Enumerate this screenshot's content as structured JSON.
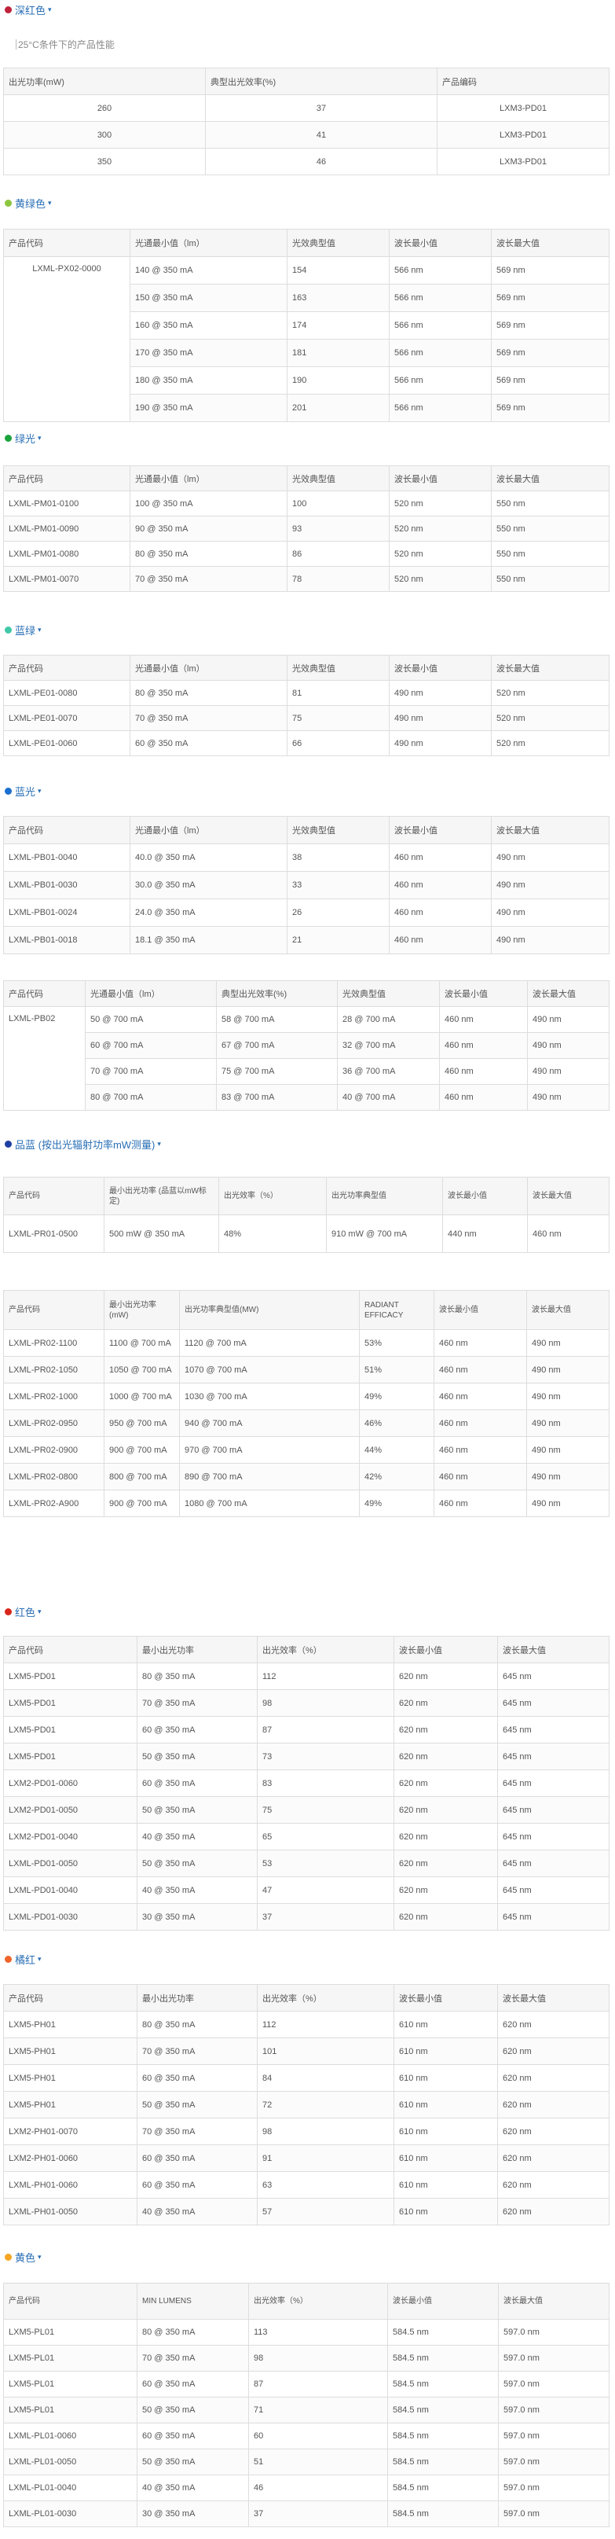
{
  "deep_red": {
    "title": "深红色",
    "color": "#c0213a",
    "note": "25°C条件下的产品性能",
    "headers": [
      "出光功率(mW)",
      "典型出光效率(%)",
      "产品编码"
    ],
    "rows": [
      [
        "260",
        "37",
        "LXM3-PD01"
      ],
      [
        "300",
        "41",
        "LXM3-PD01"
      ],
      [
        "350",
        "46",
        "LXM3-PD01"
      ]
    ]
  },
  "yellow_green": {
    "title": "黄绿色",
    "color": "#8cc63f",
    "headers": [
      "产品代码",
      "光通最小值（lm）",
      "光效典型值",
      "波长最小值",
      "波长最大值"
    ],
    "product": "LXML-PX02-0000",
    "rows": [
      [
        "140 @ 350 mA",
        "154",
        "566 nm",
        "569 nm"
      ],
      [
        "150 @ 350 mA",
        "163",
        "566 nm",
        "569 nm"
      ],
      [
        "160 @ 350 mA",
        "174",
        "566 nm",
        "569 nm"
      ],
      [
        "170 @ 350 mA",
        "181",
        "566 nm",
        "569 nm"
      ],
      [
        "180 @ 350 mA",
        "190",
        "566 nm",
        "569 nm"
      ],
      [
        "190 @ 350 mA",
        "201",
        "566 nm",
        "569 nm"
      ]
    ]
  },
  "green": {
    "title": "绿光",
    "color": "#1aa33c",
    "headers": [
      "产品代码",
      "光通最小值（lm）",
      "光效典型值",
      "波长最小值",
      "波长最大值"
    ],
    "rows": [
      [
        "LXML-PM01-0100",
        "100 @ 350 mA",
        "100",
        "520 nm",
        "550 nm"
      ],
      [
        "LXML-PM01-0090",
        "90 @ 350 mA",
        "93",
        "520 nm",
        "550 nm"
      ],
      [
        "LXML-PM01-0080",
        "80 @ 350 mA",
        "86",
        "520 nm",
        "550 nm"
      ],
      [
        "LXML-PM01-0070",
        "70 @ 350 mA",
        "78",
        "520 nm",
        "550 nm"
      ]
    ]
  },
  "cyan": {
    "title": "蓝绿",
    "color": "#3fc9a8",
    "headers": [
      "产品代码",
      "光通最小值（lm）",
      "光效典型值",
      "波长最小值",
      "波长最大值"
    ],
    "rows": [
      [
        "LXML-PE01-0080",
        "80 @ 350 mA",
        "81",
        "490 nm",
        "520 nm"
      ],
      [
        "LXML-PE01-0070",
        "70 @ 350 mA",
        "75",
        "490 nm",
        "520 nm"
      ],
      [
        "LXML-PE01-0060",
        "60 @ 350 mA",
        "66",
        "490 nm",
        "520 nm"
      ]
    ]
  },
  "blue": {
    "title": "蓝光",
    "color": "#1b6fd1",
    "headers": [
      "产品代码",
      "光通最小值（lm）",
      "光效典型值",
      "波长最小值",
      "波长最大值"
    ],
    "rows": [
      [
        "LXML-PB01-0040",
        "40.0 @ 350 mA",
        "38",
        "460 nm",
        "490 nm"
      ],
      [
        "LXML-PB01-0030",
        "30.0 @ 350 mA",
        "33",
        "460 nm",
        "490 nm"
      ],
      [
        "LXML-PB01-0024",
        "24.0 @ 350 mA",
        "26",
        "460 nm",
        "490 nm"
      ],
      [
        "LXML-PB01-0018",
        "18.1 @ 350 mA",
        "21",
        "460 nm",
        "490 nm"
      ]
    ]
  },
  "blue_pb02": {
    "headers": [
      "产品代码",
      "光通最小值（lm）",
      "典型出光效率(%)",
      "光效典型值",
      "波长最小值",
      "波长最大值"
    ],
    "product": "LXML-PB02",
    "rows": [
      [
        "50 @ 700 mA",
        "58 @ 700 mA",
        "28 @ 700 mA",
        "460 nm",
        "490 nm"
      ],
      [
        "60 @ 700 mA",
        "67 @ 700 mA",
        "32 @ 700 mA",
        "460 nm",
        "490 nm"
      ],
      [
        "70 @ 700 mA",
        "75 @ 700 mA",
        "36 @ 700 mA",
        "460 nm",
        "490 nm"
      ],
      [
        "80 @ 700 mA",
        "83 @ 700 mA",
        "40 @ 700 mA",
        "460 nm",
        "490 nm"
      ]
    ]
  },
  "royal_blue": {
    "title": "品蓝 (按出光辐射功率mW测量)",
    "color": "#1f3fa3",
    "headers": [
      "产品代码",
      "最小出光功率 (品蓝以mW标定)",
      "出光效率（%）",
      "出光功率典型值",
      "波长最小值",
      "波长最大值"
    ],
    "rows": [
      [
        "LXML-PR01-0500",
        "500 mW @ 350 mA",
        "48%",
        "910 mW @ 700 mA",
        "440 nm",
        "460 nm"
      ]
    ]
  },
  "royal_blue_pr02": {
    "headers": [
      "产品代码",
      "最小出光功率(mW)",
      "出光功率典型值(MW)",
      "RADIANT EFFICACY",
      "波长最小值",
      "波长最大值"
    ],
    "rows": [
      [
        "LXML-PR02-1100",
        "1100 @ 700 mA",
        "1120 @ 700 mA",
        "53%",
        "460 nm",
        "490 nm"
      ],
      [
        "LXML-PR02-1050",
        "1050 @ 700 mA",
        "1070 @ 700 mA",
        "51%",
        "460 nm",
        "490 nm"
      ],
      [
        "LXML-PR02-1000",
        "1000 @ 700 mA",
        "1030 @ 700 mA",
        "49%",
        "460 nm",
        "490 nm"
      ],
      [
        "LXML-PR02-0950",
        "950 @ 700 mA",
        "940 @ 700 mA",
        "46%",
        "460 nm",
        "490 nm"
      ],
      [
        "LXML-PR02-0900",
        "900 @ 700 mA",
        "970 @ 700 mA",
        "44%",
        "460 nm",
        "490 nm"
      ],
      [
        "LXML-PR02-0800",
        "800 @ 700 mA",
        "890 @ 700 mA",
        "42%",
        "460 nm",
        "490 nm"
      ],
      [
        "LXML-PR02-A900",
        "900 @ 700 mA",
        "1080 @ 700 mA",
        "49%",
        "460 nm",
        "490 nm"
      ]
    ]
  },
  "red": {
    "title": "红色",
    "color": "#d9261c",
    "headers": [
      "产品代码",
      "最小出光功率",
      "出光效率（%）",
      "波长最小值",
      "波长最大值"
    ],
    "rows": [
      [
        "LXM5-PD01",
        "80 @ 350 mA",
        "112",
        "620 nm",
        "645 nm"
      ],
      [
        "LXM5-PD01",
        "70 @ 350 mA",
        "98",
        "620 nm",
        "645 nm"
      ],
      [
        "LXM5-PD01",
        "60 @ 350 mA",
        "87",
        "620 nm",
        "645 nm"
      ],
      [
        "LXM5-PD01",
        "50 @ 350 mA",
        "73",
        "620 nm",
        "645 nm"
      ],
      [
        "LXM2-PD01-0060",
        "60 @ 350 mA",
        "83",
        "620 nm",
        "645 nm"
      ],
      [
        "LXM2-PD01-0050",
        "50 @ 350 mA",
        "75",
        "620 nm",
        "645 nm"
      ],
      [
        "LXM2-PD01-0040",
        "40 @ 350 mA",
        "65",
        "620 nm",
        "645 nm"
      ],
      [
        "LXML-PD01-0050",
        "50 @ 350 mA",
        "53",
        "620 nm",
        "645 nm"
      ],
      [
        "LXML-PD01-0040",
        "40 @ 350 mA",
        "47",
        "620 nm",
        "645 nm"
      ],
      [
        "LXML-PD01-0030",
        "30 @ 350 mA",
        "37",
        "620 nm",
        "645 nm"
      ]
    ]
  },
  "red_orange": {
    "title": "橘红",
    "color": "#f0642a",
    "headers": [
      "产品代码",
      "最小出光功率",
      "出光效率（%）",
      "波长最小值",
      "波长最大值"
    ],
    "rows": [
      [
        "LXM5-PH01",
        "80 @ 350 mA",
        "112",
        "610 nm",
        "620 nm"
      ],
      [
        "LXM5-PH01",
        "70 @ 350 mA",
        "101",
        "610 nm",
        "620 nm"
      ],
      [
        "LXM5-PH01",
        "60 @ 350 mA",
        "84",
        "610 nm",
        "620 nm"
      ],
      [
        "LXM5-PH01",
        "50 @ 350 mA",
        "72",
        "610 nm",
        "620 nm"
      ],
      [
        "LXM2-PH01-0070",
        "70 @ 350 mA",
        "98",
        "610 nm",
        "620 nm"
      ],
      [
        "LXM2-PH01-0060",
        "60 @ 350 mA",
        "91",
        "610 nm",
        "620 nm"
      ],
      [
        "LXML-PH01-0060",
        "60 @ 350 mA",
        "63",
        "610 nm",
        "620 nm"
      ],
      [
        "LXML-PH01-0050",
        "40 @ 350 mA",
        "57",
        "610 nm",
        "620 nm"
      ]
    ]
  },
  "amber": {
    "title": "黄色",
    "color": "#f5a623",
    "headers": [
      "产品代码",
      "MIN LUMENS",
      "出光效率（%）",
      "波长最小值",
      "波长最大值"
    ],
    "rows": [
      [
        "LXM5-PL01",
        "80 @ 350 mA",
        "113",
        "584.5 nm",
        "597.0 nm"
      ],
      [
        "LXM5-PL01",
        "70 @ 350 mA",
        "98",
        "584.5 nm",
        "597.0 nm"
      ],
      [
        "LXM5-PL01",
        "60 @ 350 mA",
        "87",
        "584.5 nm",
        "597.0 nm"
      ],
      [
        "LXM5-PL01",
        "50 @ 350 mA",
        "71",
        "584.5 nm",
        "597.0 nm"
      ],
      [
        "LXML-PL01-0060",
        "60 @ 350 mA",
        "60",
        "584.5 nm",
        "597.0 nm"
      ],
      [
        "LXML-PL01-0050",
        "50 @ 350 mA",
        "51",
        "584.5 nm",
        "597.0 nm"
      ],
      [
        "LXML-PL01-0040",
        "40 @ 350 mA",
        "46",
        "584.5 nm",
        "597.0 nm"
      ],
      [
        "LXML-PL01-0030",
        "30 @ 350 mA",
        "37",
        "584.5 nm",
        "597.0 nm"
      ]
    ]
  }
}
